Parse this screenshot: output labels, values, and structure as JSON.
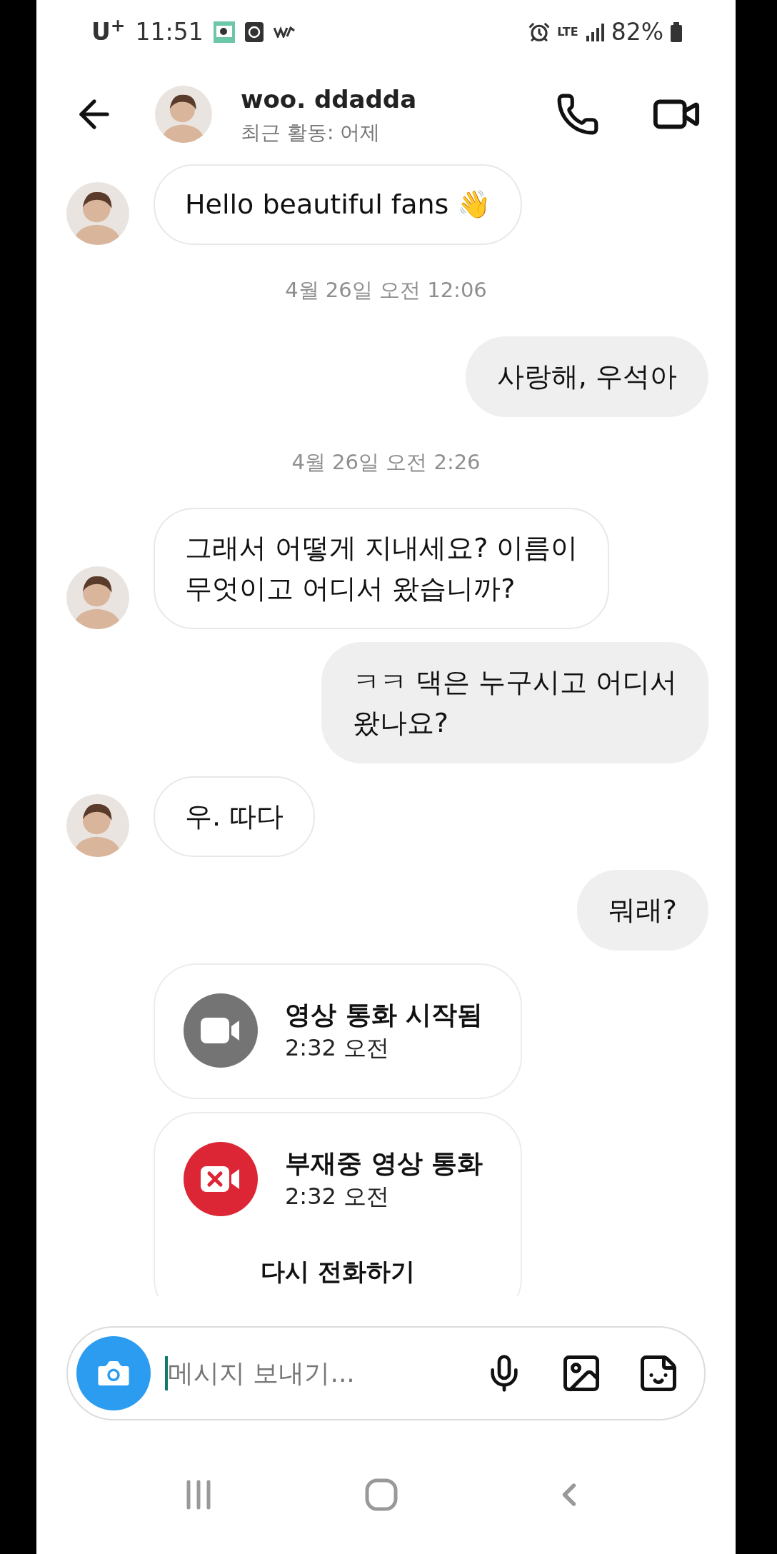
{
  "status_bar": {
    "carrier": "U$^{+}$",
    "time": "11:51",
    "network": "LTE",
    "battery": "82%"
  },
  "header": {
    "name": "woo. ddadda",
    "activity": "최근 활동: 어제"
  },
  "messages": [
    {
      "kind": "incoming",
      "text": "Hello beautiful fans 👋"
    },
    {
      "kind": "timestamp",
      "text": "4월 26일 오전 12:06"
    },
    {
      "kind": "outgoing",
      "text": "사랑해, 우석아"
    },
    {
      "kind": "timestamp",
      "text": "4월 26일 오전 2:26"
    },
    {
      "kind": "incoming",
      "text": "그래서 어떻게 지내세요? 이름이\n무엇이고 어디서 왔습니까?"
    },
    {
      "kind": "outgoing",
      "text": "ㅋㅋ 댁은 누구시고 어디서\n왔나요?"
    },
    {
      "kind": "incoming",
      "text": "우.  따다"
    },
    {
      "kind": "outgoing",
      "text": "뭐래?"
    },
    {
      "kind": "call",
      "missed": false,
      "title": "영상 통화 시작됨",
      "time": "2:32 오전"
    },
    {
      "kind": "call",
      "missed": true,
      "title": "부재중 영상 통화",
      "time": "2:32 오전",
      "action": "다시 전화하기"
    }
  ],
  "composer": {
    "placeholder": "메시지 보내기..."
  }
}
